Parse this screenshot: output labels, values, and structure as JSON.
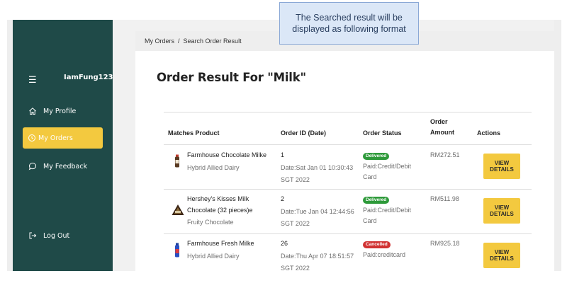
{
  "callout": {
    "text": "The Searched result will be displayed as following format"
  },
  "sidebar": {
    "username": "IamFung123",
    "items": [
      {
        "label": "My Profile"
      },
      {
        "label": "My Orders"
      },
      {
        "label": "My Feedback"
      },
      {
        "label": "Log Out"
      }
    ],
    "colors": {
      "background": "#1f4a48",
      "active": "#f3c93f"
    }
  },
  "breadcrumb": {
    "parent": "My Orders",
    "separator": "/",
    "current": "Search Order Result"
  },
  "page": {
    "title": "Order Result For \"Milk\""
  },
  "table": {
    "headers": {
      "product": "Matches Product",
      "order_id": "Order ID (Date)",
      "status": "Order Status",
      "amount_line1": "Order",
      "amount_line2": "Amount",
      "actions": "Actions"
    },
    "rows": [
      {
        "product_name": "Farmhouse Chocolate Milke",
        "brand": "Hybrid Allied Dairy",
        "product_icon": "chocolate-milk-bottle-icon",
        "order_id": "1",
        "date_line1": "Date:Sat Jan 01 10:30:43",
        "date_line2": "SGT 2022",
        "status": "Delivered",
        "status_color": "#2e9a3a",
        "payment_line1": "Paid:Credit/Debit",
        "payment_line2": "Card",
        "amount": "RM272.51",
        "action": "VIEW DETAILS"
      },
      {
        "product_name_line1": "Hershey's Kisses Milk",
        "product_name_line2": "Chocolate (32 pieces)e",
        "brand": "Fruity Chocolate",
        "product_icon": "chocolate-kisses-icon",
        "order_id": "2",
        "date_line1": "Date:Tue Jan 04 12:44:56",
        "date_line2": "SGT 2022",
        "status": "Delivered",
        "status_color": "#2e9a3a",
        "payment_line1": "Paid:Credit/Debit",
        "payment_line2": "Card",
        "amount": "RM511.98",
        "action": "VIEW DETAILS"
      },
      {
        "product_name": "Farmhouse Fresh Milke",
        "brand": "Hybrid Allied Dairy",
        "product_icon": "fresh-milk-bottle-icon",
        "order_id": "26",
        "date_line1": "Date:Thu Apr 07 18:51:57",
        "date_line2": "SGT 2022",
        "status": "Cancelled",
        "status_color": "#d13232",
        "payment_line1": "Paid:creditcard",
        "amount": "RM925.18",
        "action": "VIEW DETAILS"
      }
    ]
  }
}
